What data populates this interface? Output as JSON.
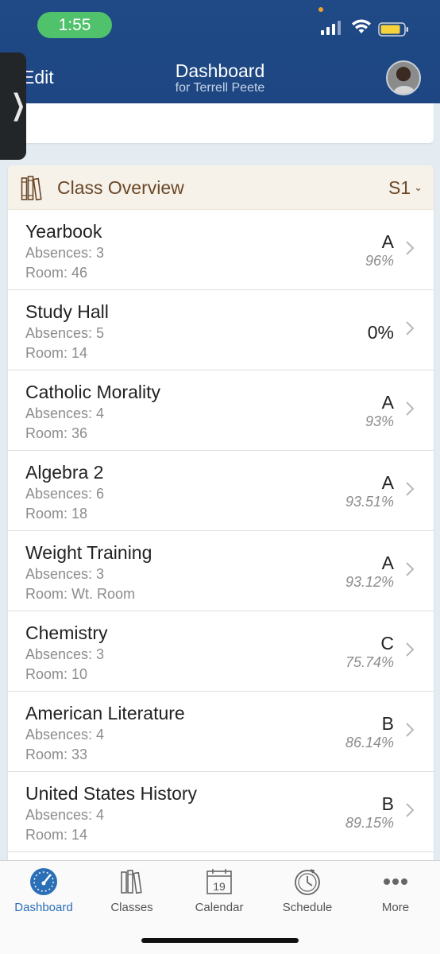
{
  "status_bar": {
    "time": "1:55"
  },
  "nav": {
    "left_label": "Edit",
    "title": "Dashboard",
    "subtitle": "for Terrell Peete"
  },
  "overview": {
    "title": "Class Overview",
    "term": "S1",
    "classes": [
      {
        "name": "Yearbook",
        "absences": "Absences: 3",
        "room": "Room: 46",
        "grade": "A",
        "percent": "96%"
      },
      {
        "name": "Study Hall",
        "absences": "Absences: 5",
        "room": "Room: 14",
        "grade": "",
        "percent": "0%"
      },
      {
        "name": "Catholic Morality",
        "absences": "Absences: 4",
        "room": "Room: 36",
        "grade": "A",
        "percent": "93%"
      },
      {
        "name": "Algebra 2",
        "absences": "Absences: 6",
        "room": "Room: 18",
        "grade": "A",
        "percent": "93.51%"
      },
      {
        "name": "Weight Training",
        "absences": "Absences: 3",
        "room": "Room: Wt. Room",
        "grade": "A",
        "percent": "93.12%"
      },
      {
        "name": "Chemistry",
        "absences": "Absences: 3",
        "room": "Room: 10",
        "grade": "C",
        "percent": "75.74%"
      },
      {
        "name": "American Literature",
        "absences": "Absences: 4",
        "room": "Room: 33",
        "grade": "B",
        "percent": "86.14%"
      },
      {
        "name": "United States History",
        "absences": "Absences: 4",
        "room": "Room: 14",
        "grade": "B",
        "percent": "89.15%"
      }
    ]
  },
  "tabbar": {
    "tabs": [
      {
        "label": "Dashboard",
        "icon": "dashboard-gauge-icon",
        "active": true
      },
      {
        "label": "Classes",
        "icon": "books-icon",
        "active": false
      },
      {
        "label": "Calendar",
        "icon": "calendar-icon",
        "active": false
      },
      {
        "label": "Schedule",
        "icon": "schedule-clock-icon",
        "active": false
      },
      {
        "label": "More",
        "icon": "more-dots-icon",
        "active": false
      }
    ],
    "calendar_day": "19"
  },
  "colors": {
    "header_blue": "#1f4a86",
    "accent_blue": "#2b6fb7",
    "overview_brown": "#6b4726",
    "status_green": "#4fc26b"
  }
}
